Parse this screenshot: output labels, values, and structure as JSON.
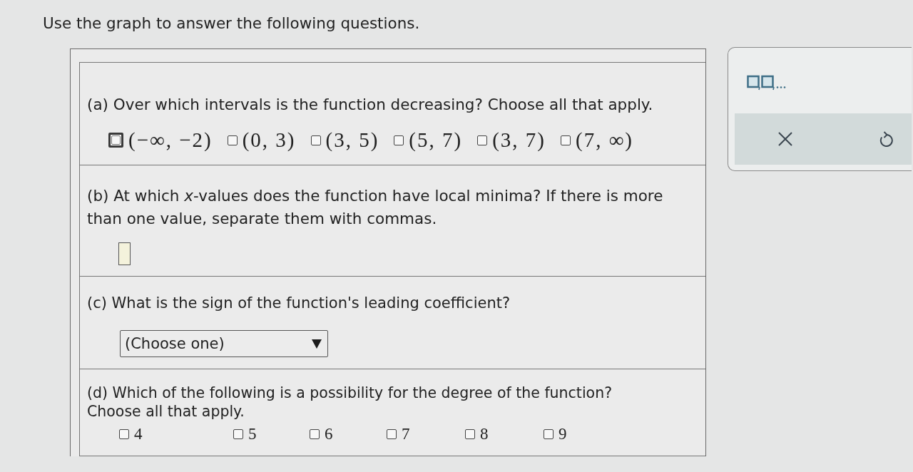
{
  "instructions": "Use the graph to answer the following questions.",
  "questions": [
    {
      "kind": "checkboxes",
      "prompt": "(a) Over which intervals is the function decreasing? Choose all that apply.",
      "options": [
        {
          "label": "(−∞, −2)",
          "checked": false,
          "focused": true
        },
        {
          "label": "(0, 3)",
          "checked": false,
          "focused": false
        },
        {
          "label": "(3, 5)",
          "checked": false,
          "focused": false
        },
        {
          "label": "(5, 7)",
          "checked": false,
          "focused": false
        },
        {
          "label": "(3, 7)",
          "checked": false,
          "focused": false
        },
        {
          "label": "(7, ∞)",
          "checked": false,
          "focused": false
        }
      ]
    },
    {
      "kind": "answer_box",
      "prompt": "(b) At which *x*-values does the function have local minima? If there is more\nthan one value, separate them with commas."
    },
    {
      "kind": "dropdown",
      "prompt": "(c) What is the sign of the function's leading coefficient?",
      "value": "(Choose one)"
    },
    {
      "kind": "checkboxes",
      "prompt": "(d) Which of the following is a possibility for the degree of the function?\nChoose all that apply.",
      "options": [
        {
          "label": "4",
          "checked": false,
          "focused": false
        },
        {
          "label": "5",
          "checked": false,
          "focused": false
        },
        {
          "label": "6",
          "checked": false,
          "focused": false
        },
        {
          "label": "7",
          "checked": false,
          "focused": false
        },
        {
          "label": "8",
          "checked": false,
          "focused": false
        },
        {
          "label": "9",
          "checked": false,
          "focused": false
        }
      ]
    }
  ]
}
